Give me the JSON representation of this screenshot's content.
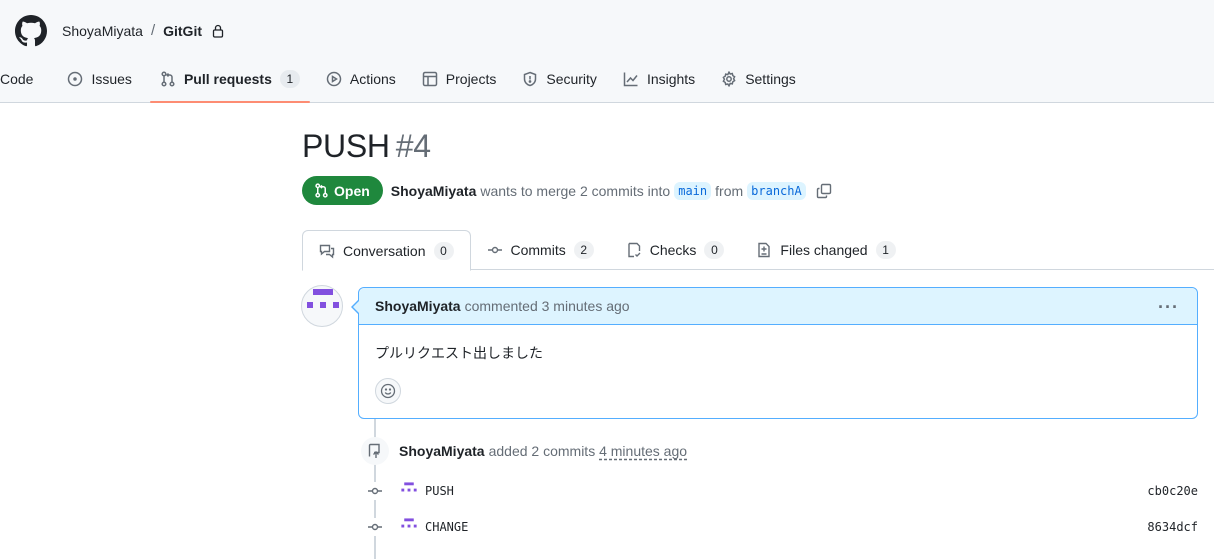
{
  "repo": {
    "owner": "ShoyaMiyata",
    "separator": "/",
    "name": "GitGit"
  },
  "nav": {
    "tabs": [
      {
        "label": "Code",
        "icon": "code-icon"
      },
      {
        "label": "Issues",
        "icon": "issue-icon"
      },
      {
        "label": "Pull requests",
        "icon": "pull-request-icon",
        "count": "1",
        "active": true
      },
      {
        "label": "Actions",
        "icon": "play-icon"
      },
      {
        "label": "Projects",
        "icon": "table-icon"
      },
      {
        "label": "Security",
        "icon": "shield-icon"
      },
      {
        "label": "Insights",
        "icon": "graph-icon"
      },
      {
        "label": "Settings",
        "icon": "gear-icon"
      }
    ]
  },
  "pr": {
    "title": "PUSH",
    "number": "#4",
    "state": "Open",
    "author": "ShoyaMiyata",
    "merge_text": "wants to merge 2 commits into",
    "base_branch": "main",
    "from_text": "from",
    "head_branch": "branchA"
  },
  "pr_tabs": [
    {
      "label": "Conversation",
      "count": "0",
      "icon": "comment-discussion-icon",
      "active": true
    },
    {
      "label": "Commits",
      "count": "2",
      "icon": "git-commit-icon"
    },
    {
      "label": "Checks",
      "count": "0",
      "icon": "checklist-icon"
    },
    {
      "label": "Files changed",
      "count": "1",
      "icon": "file-diff-icon"
    }
  ],
  "comment": {
    "author": "ShoyaMiyata",
    "action": "commented 3 minutes ago",
    "menu": "···",
    "body": "プルリクエスト出しました"
  },
  "timeline": {
    "author": "ShoyaMiyata",
    "action": "added 2 commits",
    "time": "4 minutes ago",
    "commits": [
      {
        "message": "PUSH",
        "sha": "cb0c20e"
      },
      {
        "message": "CHANGE",
        "sha": "8634dcf"
      }
    ]
  },
  "colors": {
    "open_green": "#1f883d",
    "accent_blue": "#0969da",
    "active_tab_underline": "#fd8c73",
    "avatar_purple": "#8250df"
  }
}
